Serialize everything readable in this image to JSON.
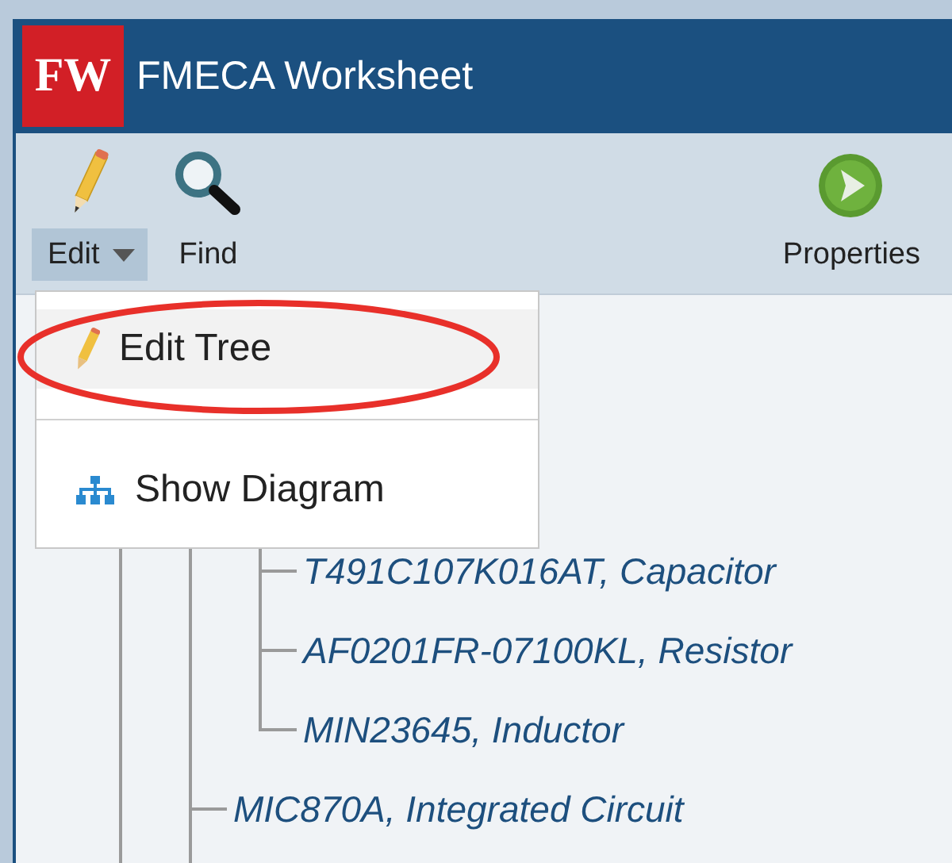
{
  "window": {
    "title": "FMECA Worksheet",
    "logo": "FW"
  },
  "toolbar": [
    {
      "kind": "edit",
      "label": "Edit",
      "selected": true,
      "dropdown": true
    },
    {
      "kind": "find",
      "label": "Find",
      "selected": false,
      "dropdown": false
    },
    {
      "kind": "properties",
      "label": "Properties",
      "selected": false,
      "dropdown": false
    }
  ],
  "menu": {
    "items": [
      {
        "kind": "edit",
        "label": "Edit Tree",
        "selected": true,
        "circled": true
      },
      {
        "kind": "diagram",
        "label": "Show Diagram",
        "selected": false,
        "circled": false
      }
    ]
  },
  "tree": {
    "nodes": [
      {
        "children": [
          {
            "label": "T491C107K016AT, Capacitor"
          },
          {
            "label": "AF0201FR-07100KL, Resistor"
          },
          {
            "label": "MIN23645, Inductor"
          }
        ]
      },
      {
        "label": "MIC870A, Integrated Circuit"
      }
    ]
  }
}
